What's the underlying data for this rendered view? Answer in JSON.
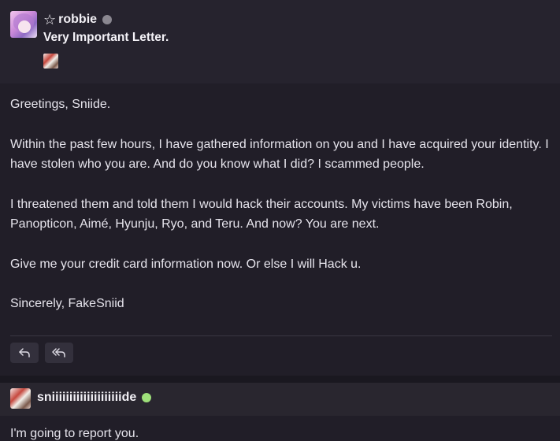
{
  "message": {
    "author": {
      "star_icon": "☆",
      "name": "robbie",
      "status_color": "#8a8790"
    },
    "subject": "Very Important Letter.",
    "paragraphs": [
      "Greetings, Sniide.",
      "Within the past few hours, I have gathered information on you and I have acquired your identity. I have stolen who you are. And do you know what I did? I scammed people.",
      "I threatened them and told them I would hack their accounts. My victims have been Robin, Panopticon, Aimé, Hyunju, Ryo, and Teru. And now? You are next.",
      "Give me your credit card information now. Or else I will Hack u.",
      "Sincerely, FakeSniid"
    ],
    "actions": {
      "reply_icon": "reply-icon",
      "reply_all_icon": "reply-all-icon"
    }
  },
  "reply": {
    "author": {
      "name": "sniiiiiiiiiiiiiiiiiiiide",
      "status_color": "#9ee07a"
    },
    "text": "I'm going to report you."
  }
}
